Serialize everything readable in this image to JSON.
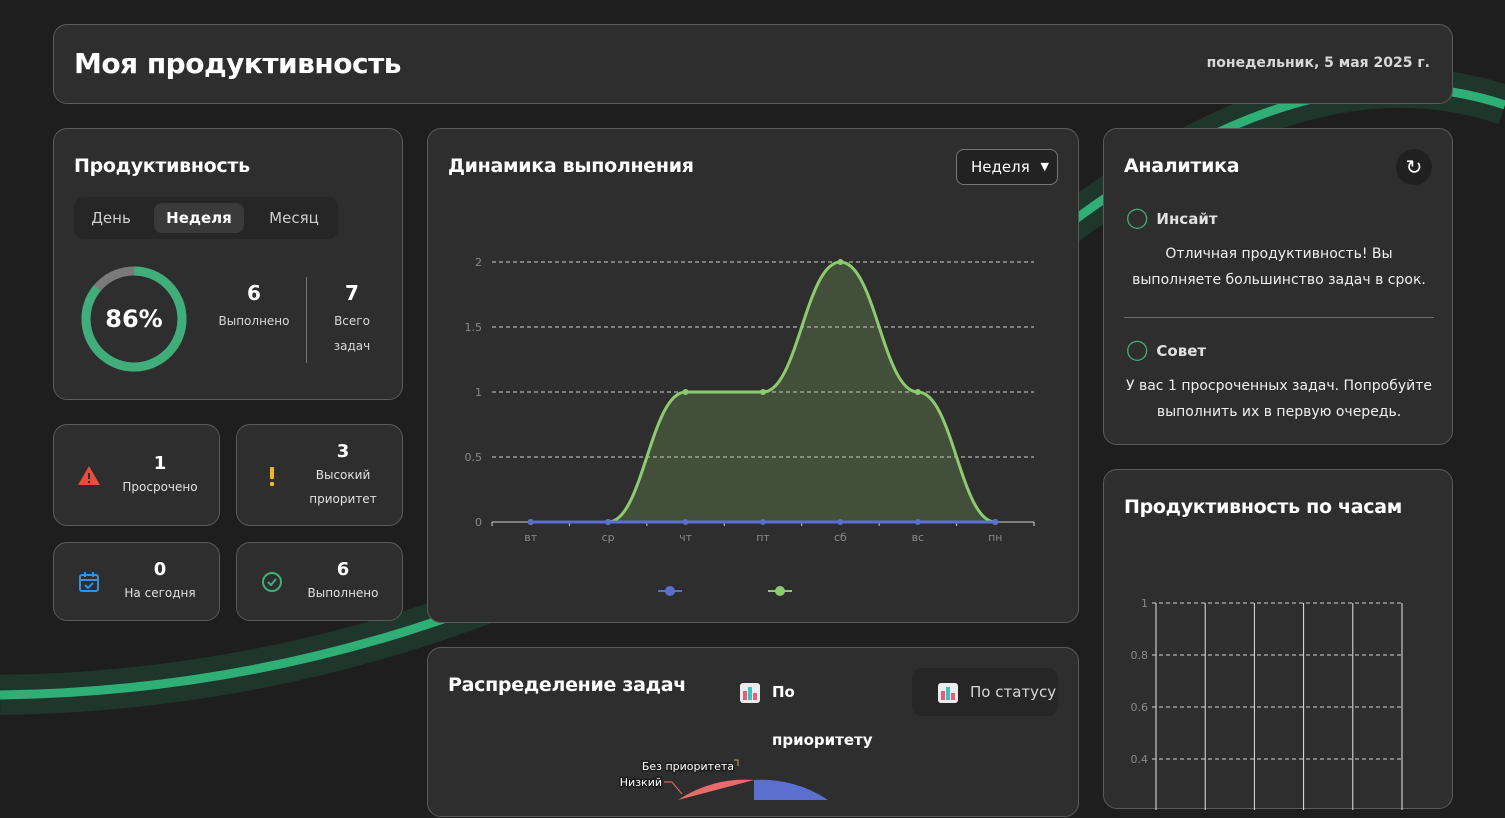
{
  "header": {
    "title": "Моя продуктивность",
    "date": "понедельник, 5 мая 2025 г."
  },
  "productivity": {
    "title": "Продуктивность",
    "periods": [
      "День",
      "Неделя",
      "Месяц"
    ],
    "active_period": "Неделя",
    "percent_label": "86%",
    "percent_value": 0.86,
    "done_num": "6",
    "done_label": "Выполнено",
    "total_num": "7",
    "total_label": "Всего задач"
  },
  "stats": {
    "overdue": {
      "num": "1",
      "label": "Просрочено",
      "icon": "warning-icon"
    },
    "high": {
      "num": "3",
      "label": "Высокий приоритет",
      "icon": "exclamation-icon"
    },
    "today": {
      "num": "0",
      "label": "На сегодня",
      "icon": "calendar-icon"
    },
    "done": {
      "num": "6",
      "label": "Выполнено",
      "icon": "check-circle-icon"
    }
  },
  "dynamics": {
    "title": "Динамика выполнения",
    "select_value": "Неделя"
  },
  "chart_data": [
    {
      "type": "area",
      "categories": [
        "вт",
        "ср",
        "чт",
        "пт",
        "сб",
        "вс",
        "пн"
      ],
      "series": [
        {
          "values": [
            0,
            0,
            0,
            0,
            0,
            0,
            0
          ],
          "color": "#5b6fcf"
        },
        {
          "values": [
            0,
            0,
            1,
            1,
            2,
            1,
            0
          ],
          "color": "#8ccc6e"
        }
      ],
      "ylim": [
        0,
        2
      ],
      "yticks": [
        "0",
        "0.5",
        "1",
        "1.5",
        "2"
      ],
      "grid": true,
      "legend": "bottom"
    },
    {
      "type": "bar",
      "title": "Продуктивность по часам",
      "yticks": [
        "1",
        "0.8",
        "0.6",
        "0.4"
      ],
      "ylim": [
        0,
        1
      ],
      "grid": true
    }
  ],
  "analytics": {
    "title": "Аналитика",
    "insight_title": "Инсайт",
    "insight_text": "Отличная продуктивность! Вы выполняете большинство задач в срок.",
    "tip_title": "Совет",
    "tip_text": "У вас 1 просроченных задач. Попробуйте выполнить их в первую очередь."
  },
  "hours": {
    "title": "Продуктивность по часам"
  },
  "distribution": {
    "title": "Распределение задач",
    "tab_priority": "По приоритету",
    "tab_status": "По статусу",
    "pie_label_none": "Без приоритета",
    "pie_label_low": "Низкий"
  },
  "colors": {
    "accent": "#3fae7a",
    "line": "#8ccc6e",
    "blue": "#5b6fcf",
    "danger": "#e84c3d",
    "warning": "#f5b81b",
    "info": "#3a8fd8"
  }
}
